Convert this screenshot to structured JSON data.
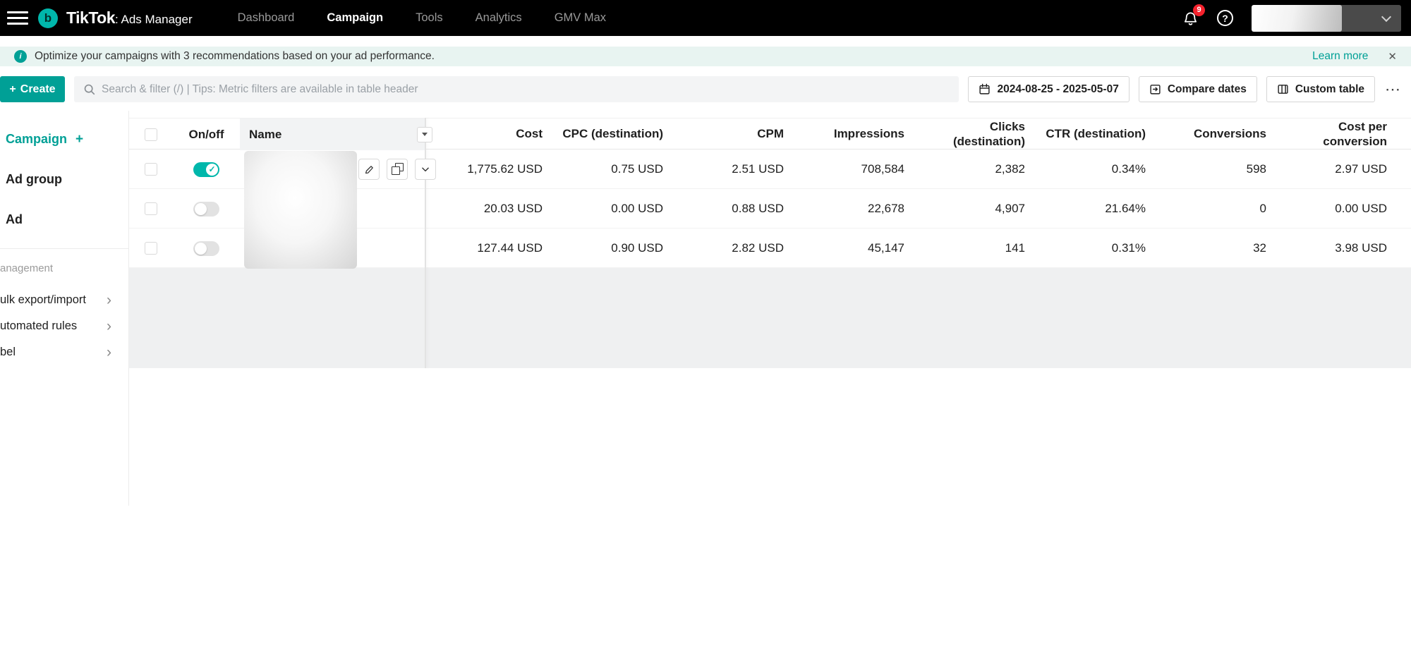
{
  "colors": {
    "accent": "#00a096",
    "toggle_on": "#00b7ab",
    "notification_badge": "#f5222d",
    "banner_bg": "#e8f4f1"
  },
  "topbar": {
    "logo_letter": "b",
    "brand": "TikTok",
    "brand_suffix": ": Ads Manager",
    "nav": [
      {
        "label": "Dashboard",
        "active": false
      },
      {
        "label": "Campaign",
        "active": true
      },
      {
        "label": "Tools",
        "active": false
      },
      {
        "label": "Analytics",
        "active": false
      },
      {
        "label": "GMV Max",
        "active": false
      }
    ],
    "notification_count": "9",
    "help_glyph": "?"
  },
  "banner": {
    "info_glyph": "i",
    "message": "Optimize your campaigns with 3 recommendations based on your ad performance.",
    "learn_more_label": "Learn more",
    "close_glyph": "✕"
  },
  "toolbar": {
    "create_plus": "+",
    "create_label": "Create",
    "search_placeholder": "Search & filter (/) | Tips: Metric filters are available in table header",
    "date_range_label": "2024-08-25 - 2025-05-07",
    "compare_dates_label": "Compare dates",
    "custom_table_label": "Custom table",
    "more_glyph": "⋯"
  },
  "sidebar": {
    "plus_glyph": "+",
    "chevron_glyph": "›",
    "nav_items": [
      {
        "label": "Campaign",
        "active": true
      },
      {
        "label": "Ad group",
        "active": false
      },
      {
        "label": "Ad",
        "active": false
      }
    ],
    "section_label": "anagement",
    "links": [
      {
        "label": "ulk export/import"
      },
      {
        "label": "utomated rules"
      },
      {
        "label": "bel"
      }
    ]
  },
  "table": {
    "columns": {
      "onoff": "On/off",
      "name": "Name",
      "metrics": [
        "Cost",
        "CPC (destination)",
        "CPM",
        "Impressions",
        "Clicks (destination)",
        "CTR (destination)",
        "Conversions",
        "Cost per conversion"
      ]
    },
    "rows": [
      {
        "enabled": true,
        "metrics": [
          "1,775.62 USD",
          "0.75 USD",
          "2.51 USD",
          "708,584",
          "2,382",
          "0.34%",
          "598",
          "2.97 USD"
        ]
      },
      {
        "enabled": false,
        "metrics": [
          "20.03 USD",
          "0.00 USD",
          "0.88 USD",
          "22,678",
          "4,907",
          "21.64%",
          "0",
          "0.00 USD"
        ]
      },
      {
        "enabled": false,
        "metrics": [
          "127.44 USD",
          "0.90 USD",
          "2.82 USD",
          "45,147",
          "141",
          "0.31%",
          "32",
          "3.98 USD"
        ]
      }
    ]
  }
}
